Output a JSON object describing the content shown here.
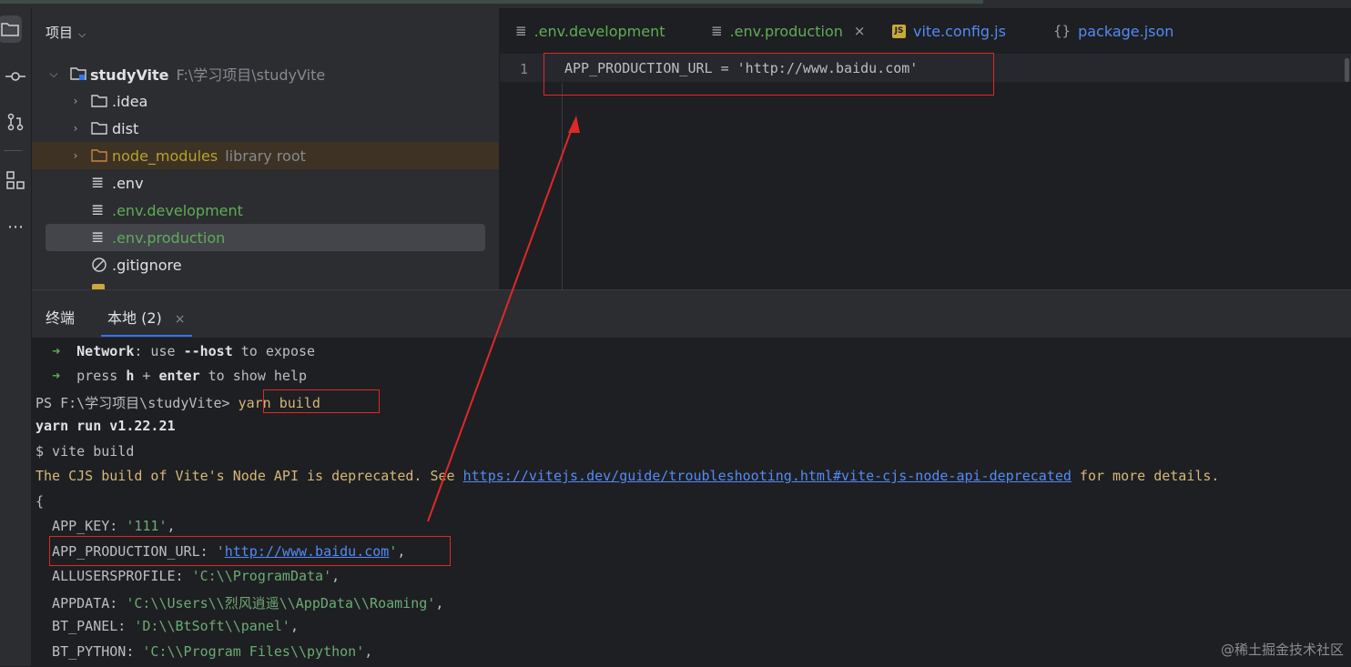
{
  "project_panel": {
    "title": "项目",
    "root": {
      "name": "studyVite",
      "path": "F:\\学习项目\\studyVite"
    },
    "items": [
      {
        "label": ".idea",
        "hint": ""
      },
      {
        "label": "dist",
        "hint": ""
      },
      {
        "label": "node_modules",
        "hint": "library root"
      },
      {
        "label": ".env",
        "hint": ""
      },
      {
        "label": ".env.development",
        "hint": ""
      },
      {
        "label": ".env.production",
        "hint": ""
      },
      {
        "label": ".gitignore",
        "hint": ""
      }
    ]
  },
  "editor": {
    "tabs": [
      {
        "label": ".env.development"
      },
      {
        "label": ".env.production",
        "close": "×"
      },
      {
        "label": "vite.config.js",
        "badge": "JS"
      },
      {
        "label": "package.json",
        "icon": "{}"
      }
    ],
    "line_number": "1",
    "code_line": "APP_PRODUCTION_URL = 'http://www.baidu.com'"
  },
  "terminal": {
    "tabs": [
      {
        "label": "终端"
      },
      {
        "label": "本地 (2)",
        "close": "×"
      }
    ],
    "net_label": "Network",
    "net_mid": ": use ",
    "net_flag": "--host",
    "net_end": " to expose",
    "help_pre": "press ",
    "help_h": "h",
    "help_plus": " + ",
    "help_enter": "enter",
    "help_end": " to show help",
    "prompt": "PS F:\\学习项目\\studyVite> ",
    "cmd": "yarn build",
    "yarn_run": "yarn run v1.22.21",
    "vite_build": "$ vite build",
    "warn_pre": "The CJS build of Vite's Node API is deprecated. See ",
    "warn_link": "https://vitejs.dev/guide/troubleshooting.html#vite-cjs-node-api-deprecated",
    "warn_post": " for more details.",
    "brace": "{",
    "env": {
      "app_key_k": "  APP_KEY: ",
      "app_key_v": "'111'",
      "prod_k": "  APP_PRODUCTION_URL: ",
      "prod_q": "'",
      "prod_link": "http://www.baidu.com",
      "all_k": "  ALLUSERSPROFILE: ",
      "all_v": "'C:\\\\ProgramData'",
      "appdata_k": "  APPDATA: ",
      "appdata_v": "'C:\\\\Users\\\\烈风逍遥\\\\AppData\\\\Roaming'",
      "bt_panel_k": "  BT_PANEL: ",
      "bt_panel_v": "'D:\\\\BtSoft\\\\panel'",
      "bt_python_k": "  BT_PYTHON: ",
      "bt_python_v": "'C:\\\\Program Files\\\\python'"
    }
  },
  "watermark": "@稀土掘金技术社区",
  "colors": {
    "annotation_red": "#e02828",
    "accent_blue": "#3574f0",
    "vcs_green": "#5fad56"
  }
}
